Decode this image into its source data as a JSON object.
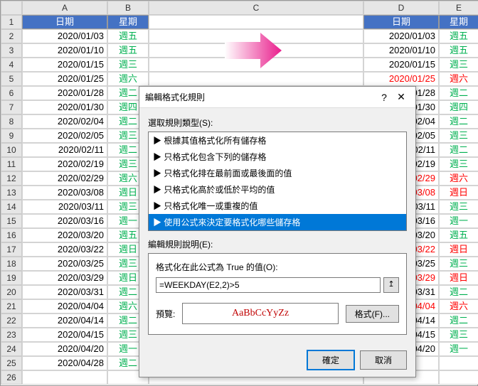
{
  "columns": [
    "A",
    "B",
    "C",
    "D",
    "E"
  ],
  "header": {
    "date": "日期",
    "weekday": "星期"
  },
  "rows": [
    {
      "n": 1,
      "A": "日期",
      "B": "星期",
      "D": "日期",
      "E": "星期",
      "hdr": true
    },
    {
      "n": 2,
      "A": "2020/01/03",
      "B": "週五",
      "Bc": "green",
      "D": "2020/01/03",
      "E": "週五",
      "Ec": "green"
    },
    {
      "n": 3,
      "A": "2020/01/10",
      "B": "週五",
      "Bc": "green",
      "D": "2020/01/10",
      "E": "週五",
      "Ec": "green"
    },
    {
      "n": 4,
      "A": "2020/01/15",
      "B": "週三",
      "Bc": "green",
      "D": "2020/01/15",
      "E": "週三",
      "Ec": "green"
    },
    {
      "n": 5,
      "A": "2020/01/25",
      "B": "週六",
      "Bc": "green",
      "D": "2020/01/25",
      "Dc": "red",
      "E": "週六",
      "Ec": "red"
    },
    {
      "n": 6,
      "A": "2020/01/28",
      "B": "週二",
      "Bc": "green",
      "D": "/01/28",
      "E": "週二",
      "Ec": "green"
    },
    {
      "n": 7,
      "A": "2020/01/30",
      "B": "週四",
      "Bc": "green",
      "D": "/01/30",
      "E": "週四",
      "Ec": "green"
    },
    {
      "n": 8,
      "A": "2020/02/04",
      "B": "週二",
      "Bc": "green",
      "D": "/02/04",
      "E": "週二",
      "Ec": "green"
    },
    {
      "n": 9,
      "A": "2020/02/05",
      "B": "週三",
      "Bc": "green",
      "D": "/02/05",
      "E": "週三",
      "Ec": "green"
    },
    {
      "n": 10,
      "A": "2020/02/11",
      "B": "週二",
      "Bc": "green",
      "D": "/02/11",
      "E": "週二",
      "Ec": "green"
    },
    {
      "n": 11,
      "A": "2020/02/19",
      "B": "週三",
      "Bc": "green",
      "D": "/02/19",
      "E": "週三",
      "Ec": "green"
    },
    {
      "n": 12,
      "A": "2020/02/29",
      "B": "週六",
      "Bc": "green",
      "D": "/02/29",
      "Dc": "red",
      "E": "週六",
      "Ec": "red"
    },
    {
      "n": 13,
      "A": "2020/03/08",
      "B": "週日",
      "Bc": "green",
      "D": "/03/08",
      "Dc": "red",
      "E": "週日",
      "Ec": "red"
    },
    {
      "n": 14,
      "A": "2020/03/11",
      "B": "週三",
      "Bc": "green",
      "D": "/03/11",
      "E": "週三",
      "Ec": "green"
    },
    {
      "n": 15,
      "A": "2020/03/16",
      "B": "週一",
      "Bc": "green",
      "D": "/03/16",
      "E": "週一",
      "Ec": "green"
    },
    {
      "n": 16,
      "A": "2020/03/20",
      "B": "週五",
      "Bc": "green",
      "D": "/03/20",
      "E": "週五",
      "Ec": "green"
    },
    {
      "n": 17,
      "A": "2020/03/22",
      "B": "週日",
      "Bc": "green",
      "D": "/03/22",
      "Dc": "red",
      "E": "週日",
      "Ec": "red"
    },
    {
      "n": 18,
      "A": "2020/03/25",
      "B": "週三",
      "Bc": "green",
      "D": "/03/25",
      "E": "週三",
      "Ec": "green"
    },
    {
      "n": 19,
      "A": "2020/03/29",
      "B": "週日",
      "Bc": "green",
      "D": "/03/29",
      "Dc": "red",
      "E": "週日",
      "Ec": "red"
    },
    {
      "n": 20,
      "A": "2020/03/31",
      "B": "週二",
      "Bc": "green",
      "D": "/03/31",
      "E": "週二",
      "Ec": "green"
    },
    {
      "n": 21,
      "A": "2020/04/04",
      "B": "週六",
      "Bc": "green",
      "D": "/04/04",
      "Dc": "red",
      "E": "週六",
      "Ec": "red"
    },
    {
      "n": 22,
      "A": "2020/04/14",
      "B": "週二",
      "Bc": "green",
      "D": "/04/14",
      "E": "週二",
      "Ec": "green"
    },
    {
      "n": 23,
      "A": "2020/04/15",
      "B": "週三",
      "Bc": "green",
      "D": "/04/15",
      "E": "週三",
      "Ec": "green"
    },
    {
      "n": 24,
      "A": "2020/04/20",
      "B": "週一",
      "Bc": "green",
      "D": "/04/20",
      "E": "週一",
      "Ec": "green"
    },
    {
      "n": 25,
      "A": "2020/04/28",
      "B": "週二",
      "Bc": "green",
      "D": "",
      "E": ""
    },
    {
      "n": 26,
      "A": "",
      "B": "",
      "D": "",
      "E": ""
    }
  ],
  "dialog": {
    "title": "編輯格式化規則",
    "help": "?",
    "close": "✕",
    "select_rule_label": "選取規則類型(S):",
    "rules": [
      "▶ 根據其值格式化所有儲存格",
      "▶ 只格式化包含下列的儲存格",
      "▶ 只格式化排在最前面或最後面的值",
      "▶ 只格式化高於或低於平均的值",
      "▶ 只格式化唯一或重複的值",
      "▶ 使用公式來決定要格式化哪些儲存格"
    ],
    "selected_rule_index": 5,
    "edit_desc_label": "編輯規則說明(E):",
    "formula_label": "格式化在此公式為 True 的值(O):",
    "formula": "=WEEKDAY(E2,2)>5",
    "preview_label": "預覽:",
    "preview_text": "AaBbCcYyZz",
    "format_btn": "格式(F)...",
    "ok": "確定",
    "cancel": "取消"
  }
}
